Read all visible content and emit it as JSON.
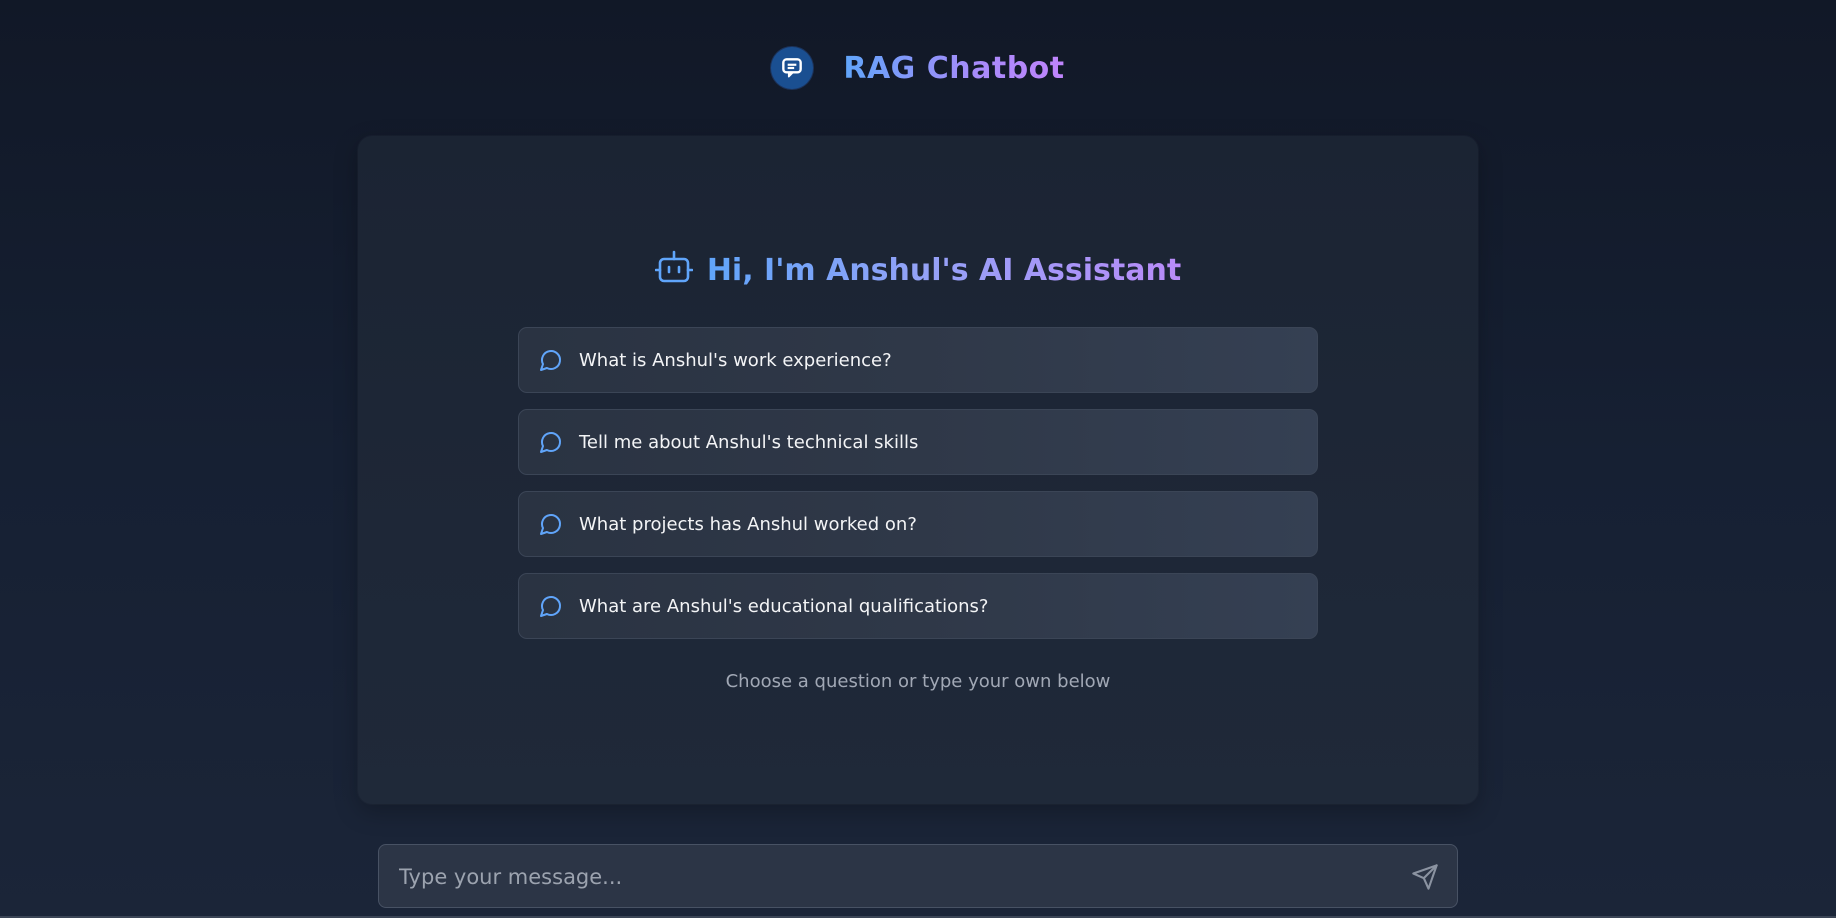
{
  "header": {
    "title": "RAG Chatbot",
    "logo_icon": "chat-bubble-icon"
  },
  "welcome": {
    "icon": "robot-icon",
    "title": "Hi, I'm Anshul's AI Assistant"
  },
  "suggestions": [
    {
      "icon": "message-circle-icon",
      "label": "What is Anshul's work experience?"
    },
    {
      "icon": "message-circle-icon",
      "label": "Tell me about Anshul's technical skills"
    },
    {
      "icon": "message-circle-icon",
      "label": "What projects has Anshul worked on?"
    },
    {
      "icon": "message-circle-icon",
      "label": "What are Anshul's educational qualifications?"
    }
  ],
  "hint": "Choose a question or type your own below",
  "composer": {
    "placeholder": "Type your message...",
    "value": "",
    "send_icon": "send-icon"
  },
  "colors": {
    "background": "#111827",
    "panel": "#1e2737",
    "accent_blue": "#60a5fa",
    "accent_purple": "#c084fc",
    "logo_bg": "#1a4f91"
  }
}
